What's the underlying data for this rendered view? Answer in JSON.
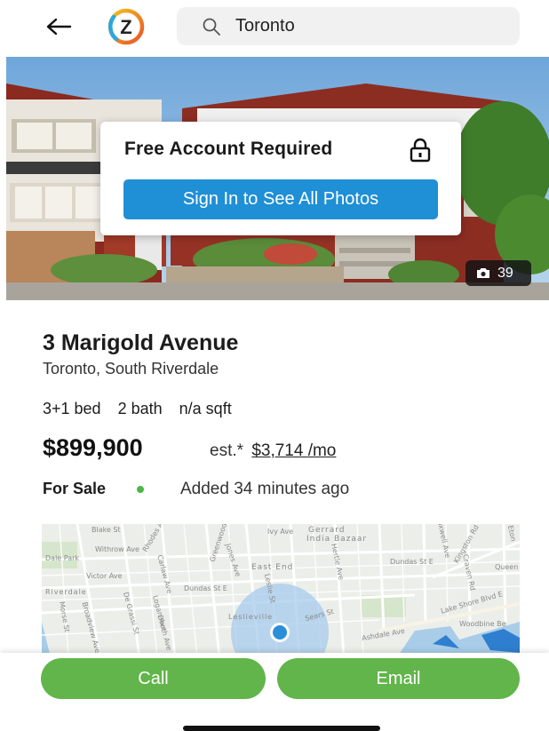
{
  "header": {
    "search_value": "Toronto",
    "logo_letter": "Z"
  },
  "photo": {
    "overlay_title": "Free Account Required",
    "signin_label": "Sign In to See All Photos",
    "photo_count": "39"
  },
  "listing": {
    "address": "3 Marigold Avenue",
    "location": "Toronto, South Riverdale",
    "beds": "3+1 bed",
    "baths": "2 bath",
    "sqft": "n/a sqft",
    "price": "$899,900",
    "est_prefix": "est.*",
    "est_monthly": "$3,714 /mo",
    "status": "For Sale",
    "added": "Added 34 minutes ago"
  },
  "map": {
    "labels": [
      "Withrow Ave",
      "Gerrard",
      "India Bazaar",
      "Victor Ave",
      "East End",
      "Dundas St E",
      "Queen",
      "Riverdale",
      "Dundas St E",
      "Leslieville",
      "Lake Shore Blvd E",
      "Woodbine Be",
      "Kingston Rd",
      "Jones Ave",
      "Carlaw Ave",
      "Logan Ave",
      "Broadview Ave",
      "De Grassi St",
      "Booth Ave",
      "Morse St",
      "Hertle Ave",
      "Leslie St",
      "Sears St",
      "Coxwell Ave",
      "Ivy Ave",
      "Dale Park",
      "Eton",
      "Greenwood Ave",
      "Rhodes Ave",
      "Craven Rd",
      "Blake St",
      "Ashdale Ave"
    ]
  },
  "actions": {
    "call_label": "Call",
    "email_label": "Email"
  },
  "colors": {
    "accent_blue": "#1f8fd6",
    "action_green": "#62b54a",
    "status_green": "#4cb848",
    "map_marker": "#2a8fd8"
  }
}
